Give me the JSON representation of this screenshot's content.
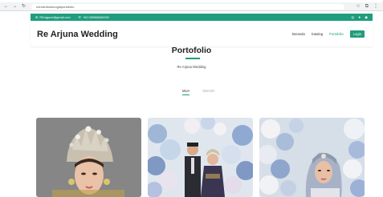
{
  "browser": {
    "url": "reendufstohuogdiportofolio"
  },
  "topbar": {
    "email": "REragune@gmail.com",
    "phone": "+62 089508460000",
    "accent": "#1f9d7c"
  },
  "header": {
    "brand": "Re Arjuna Wedding",
    "nav": [
      "Beranda",
      "Katalog",
      "Portofolio"
    ],
    "login": "Login"
  },
  "section": {
    "title": "Portofolio",
    "subtitle": "Re Arjuna Wedding"
  },
  "tabs": [
    "MUA",
    "DEKOR"
  ],
  "gallery": [
    {
      "name": "bride-portrait-photo"
    },
    {
      "name": "couple-decor-photo"
    },
    {
      "name": "bride-hijab-photo"
    }
  ]
}
